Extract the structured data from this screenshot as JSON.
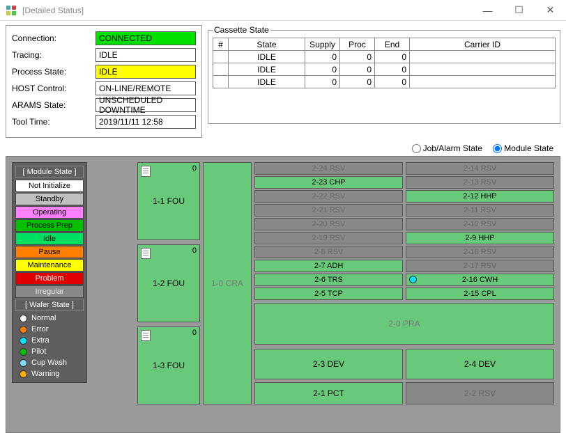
{
  "window": {
    "title": "[Detailed Status]"
  },
  "status": {
    "connection_label": "Connection:",
    "connection": "CONNECTED",
    "tracing_label": "Tracing:",
    "tracing": "IDLE",
    "process_state_label": "Process State:",
    "process_state": "IDLE",
    "host_control_label": "HOST Control:",
    "host_control": "ON-LINE/REMOTE",
    "arams_state_label": "ARAMS State:",
    "arams_state": "UNSCHEDULED DOWNTIME",
    "tool_time_label": "Tool Time:",
    "tool_time": "2019/11/11  12:58"
  },
  "cassette": {
    "legend": "Cassette State",
    "headers": {
      "num": "#",
      "state": "State",
      "supply": "Supply",
      "proc": "Proc",
      "end": "End",
      "carrier": "Carrier ID"
    },
    "rows": [
      {
        "num": "",
        "state": "IDLE",
        "supply": "0",
        "proc": "0",
        "end": "0",
        "carrier": ""
      },
      {
        "num": "",
        "state": "IDLE",
        "supply": "0",
        "proc": "0",
        "end": "0",
        "carrier": ""
      },
      {
        "num": "",
        "state": "IDLE",
        "supply": "0",
        "proc": "0",
        "end": "0",
        "carrier": ""
      }
    ]
  },
  "radios": {
    "job_alarm": "Job/Alarm State",
    "module": "Module State"
  },
  "legend": {
    "module_header": "[ Module State ]",
    "not_init": "Not Initialize",
    "standby": "Standby",
    "operating": "Operating",
    "process_prep": "Process Prep",
    "idle": "Idle",
    "pause": "Pause",
    "maintenance": "Maintenance",
    "problem": "Problem",
    "irregular": "Irregular",
    "wafer_header": "[ Wafer State ]",
    "normal": "Normal",
    "error": "Error",
    "extra": "Extra",
    "pilot": "Pilot",
    "cup_wash": "Cup Wash",
    "warning": "Warning"
  },
  "modules": {
    "fou1": {
      "label": "1-1 FOU",
      "count": "0"
    },
    "fou2": {
      "label": "1-2 FOU",
      "count": "0"
    },
    "fou3": {
      "label": "1-3 FOU",
      "count": "0"
    },
    "cra": {
      "label": "1-0 CRA"
    },
    "rows": [
      {
        "l": "2-24 RSV",
        "lc": "grey",
        "r": "2-14 RSV",
        "rc": "grey"
      },
      {
        "l": "2-23 CHP",
        "lc": "green",
        "r": "2-13 RSV",
        "rc": "grey"
      },
      {
        "l": "2-22 RSV",
        "lc": "grey",
        "r": "2-12 HHP",
        "rc": "green"
      },
      {
        "l": "2-21 RSV",
        "lc": "grey",
        "r": "2-11 RSV",
        "rc": "grey"
      },
      {
        "l": "2-20 RSV",
        "lc": "grey",
        "r": "2-10 RSV",
        "rc": "grey"
      },
      {
        "l": "2-19 RSV",
        "lc": "grey",
        "r": "2-9 HHP",
        "rc": "green"
      },
      {
        "l": "2-8 RSV",
        "lc": "grey",
        "r": "2-18 RSV",
        "rc": "grey"
      },
      {
        "l": "2-7 ADH",
        "lc": "green",
        "r": "2-17 RSV",
        "rc": "grey"
      },
      {
        "l": "2-6 TRS",
        "lc": "green",
        "r": "2-16 CWH",
        "rc": "green",
        "rdot": true
      },
      {
        "l": "2-5 TCP",
        "lc": "green",
        "r": "2-15 CPL",
        "rc": "green"
      }
    ],
    "pra": "2-0 PRA",
    "dev_l": "2-3 DEV",
    "dev_r": "2-4 DEV",
    "pct": "2-1 PCT",
    "rsv22": "2-2 RSV"
  }
}
